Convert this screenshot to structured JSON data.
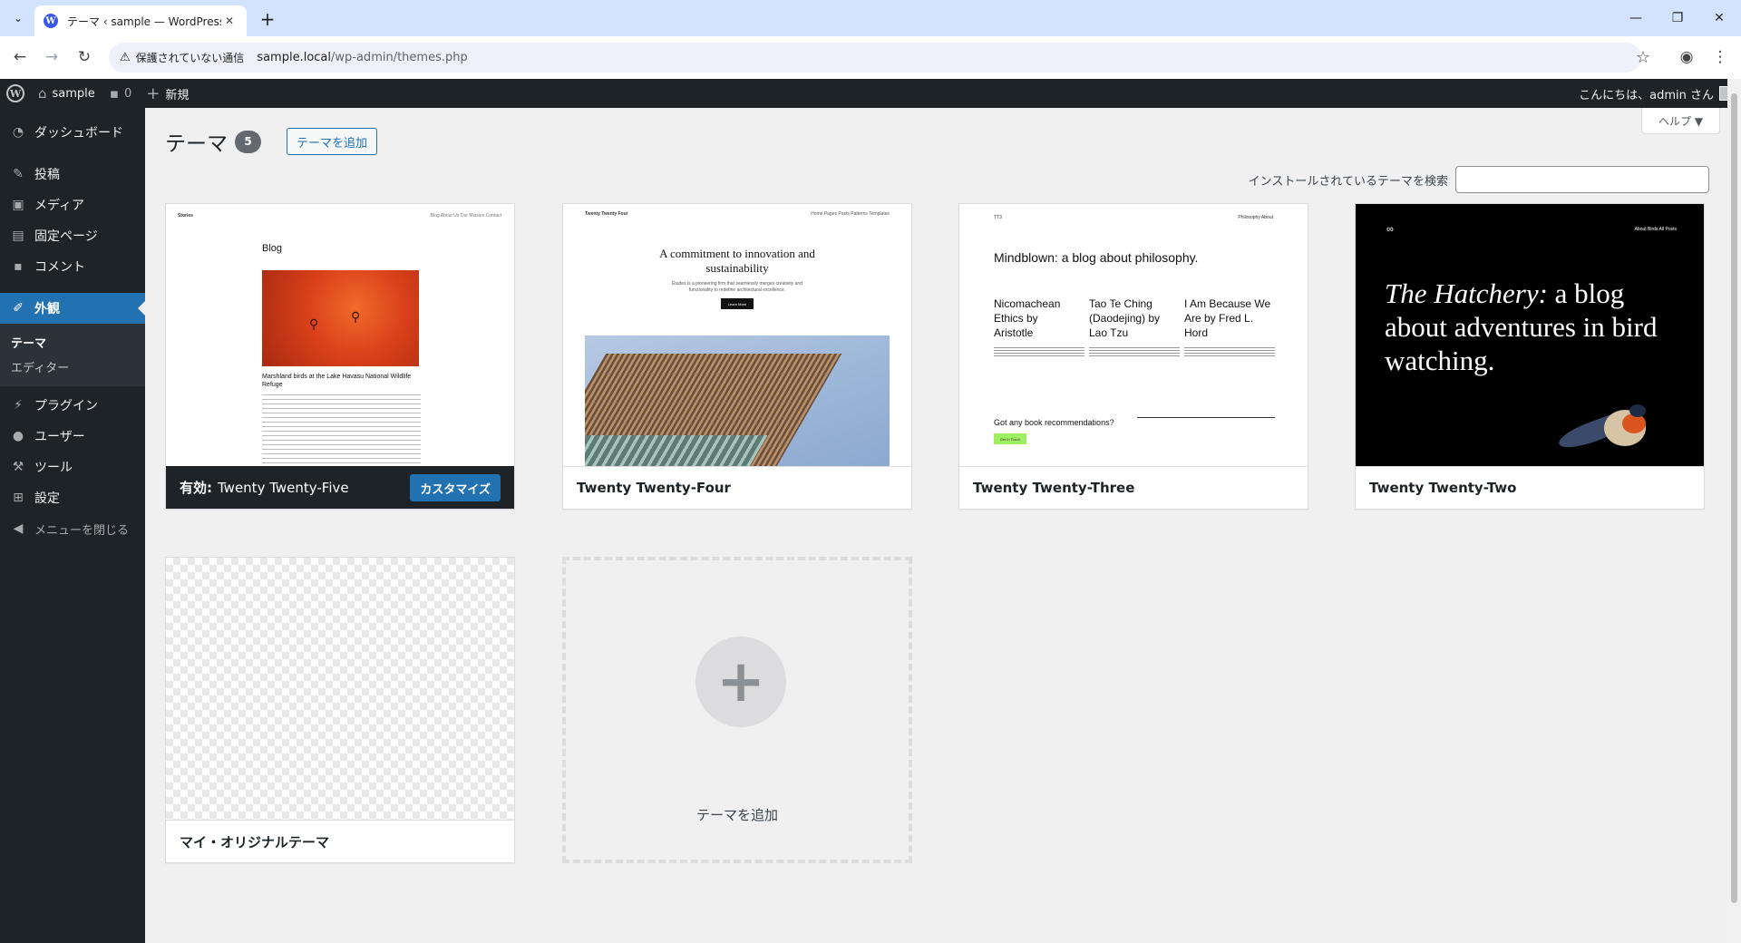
{
  "browser": {
    "tab_title": "テーマ ‹ sample — WordPress",
    "tab_favicon": "W",
    "url_warning": "保護されていない通信",
    "url_host": "sample.local",
    "url_path": "/wp-admin/themes.php"
  },
  "adminbar": {
    "site_name": "sample",
    "comments_count": "0",
    "new_label": "新規",
    "greeting": "こんにちは、admin さん"
  },
  "sidebar": {
    "dashboard": "ダッシュボード",
    "posts": "投稿",
    "media": "メディア",
    "pages": "固定ページ",
    "comments": "コメント",
    "appearance": "外観",
    "sub_themes": "テーマ",
    "sub_editor": "エディター",
    "plugins": "プラグイン",
    "users": "ユーザー",
    "tools": "ツール",
    "settings": "設定",
    "collapse": "メニューを閉じる"
  },
  "main": {
    "help": "ヘルプ ▼",
    "title": "テーマ",
    "count": "5",
    "add_button": "テーマを追加",
    "search_label": "インストールされているテーマを検索",
    "search_value": ""
  },
  "themes": [
    {
      "name": "Twenty Twenty-Five",
      "active_prefix": "有効:",
      "customize": "カスタマイズ",
      "shot": {
        "site": "Stories",
        "nav": "Blog   About Us   Our Mission   Contact",
        "heading": "Blog",
        "caption": "Marshland birds at the Lake Havasu National Wildlife Refuge"
      }
    },
    {
      "name": "Twenty Twenty-Four",
      "shot": {
        "site": "Twenty Twenty Four",
        "nav": "Home   Pages   Posts   Patterns   Templates",
        "headline": "A commitment to innovation and sustainability",
        "sub": "Études is a pioneering firm that seamlessly merges creativity and functionality to redefine architectural excellence.",
        "button": "Learn More"
      }
    },
    {
      "name": "Twenty Twenty-Three",
      "shot": {
        "site": "TT3",
        "nav": "Philosophy   About",
        "headline": "Mindblown: a blog about philosophy.",
        "col1": "Nicomachean Ethics by Aristotle",
        "col2": "Tao Te Ching (Daodejing) by Lao Tzu",
        "col3": "I Am Because We Are by Fred L. Hord",
        "question": "Got any book recommendations?",
        "button": "Get In Touch"
      }
    },
    {
      "name": "Twenty Twenty-Two",
      "shot": {
        "nav": "About   Birds   All Posts",
        "headline_italic": "The Hatchery:",
        "headline_rest": " a blog about adventures in bird watching."
      }
    },
    {
      "name": "マイ・オリジナルテーマ"
    }
  ],
  "add_new_label": "テーマを追加",
  "colors": {
    "wp_blue": "#2271b1",
    "admin_dark": "#1d2327",
    "bg": "#f0f0f1"
  }
}
